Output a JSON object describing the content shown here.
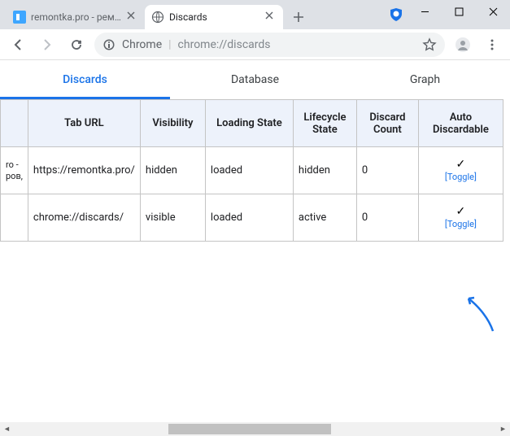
{
  "window": {
    "tabs": [
      {
        "title": "remontka.pro - ремон",
        "active": false,
        "favicon": "site"
      },
      {
        "title": "Discards",
        "active": true,
        "favicon": "globe"
      }
    ]
  },
  "toolbar": {
    "omnibox_prefix": "Chrome",
    "omnibox_url": "chrome://discards"
  },
  "subnav": {
    "tabs": [
      {
        "label": "Discards",
        "active": true
      },
      {
        "label": "Database",
        "active": false
      },
      {
        "label": "Graph",
        "active": false
      }
    ]
  },
  "table": {
    "headers": [
      "Tab URL",
      "Visibility",
      "Loading State",
      "Lifecycle State",
      "Discard Count",
      "Auto Discardable"
    ],
    "row_prefix": [
      "ro -",
      "ров,"
    ],
    "rows": [
      {
        "url": "https://remontka.pro/",
        "visibility": "hidden",
        "loading": "loaded",
        "lifecycle": "hidden",
        "discard_count": "0",
        "auto_check": "✓",
        "auto_toggle": "[Toggle]"
      },
      {
        "url": "chrome://discards/",
        "visibility": "visible",
        "loading": "loaded",
        "lifecycle": "active",
        "discard_count": "0",
        "auto_check": "✓",
        "auto_toggle": "[Toggle]"
      }
    ]
  }
}
